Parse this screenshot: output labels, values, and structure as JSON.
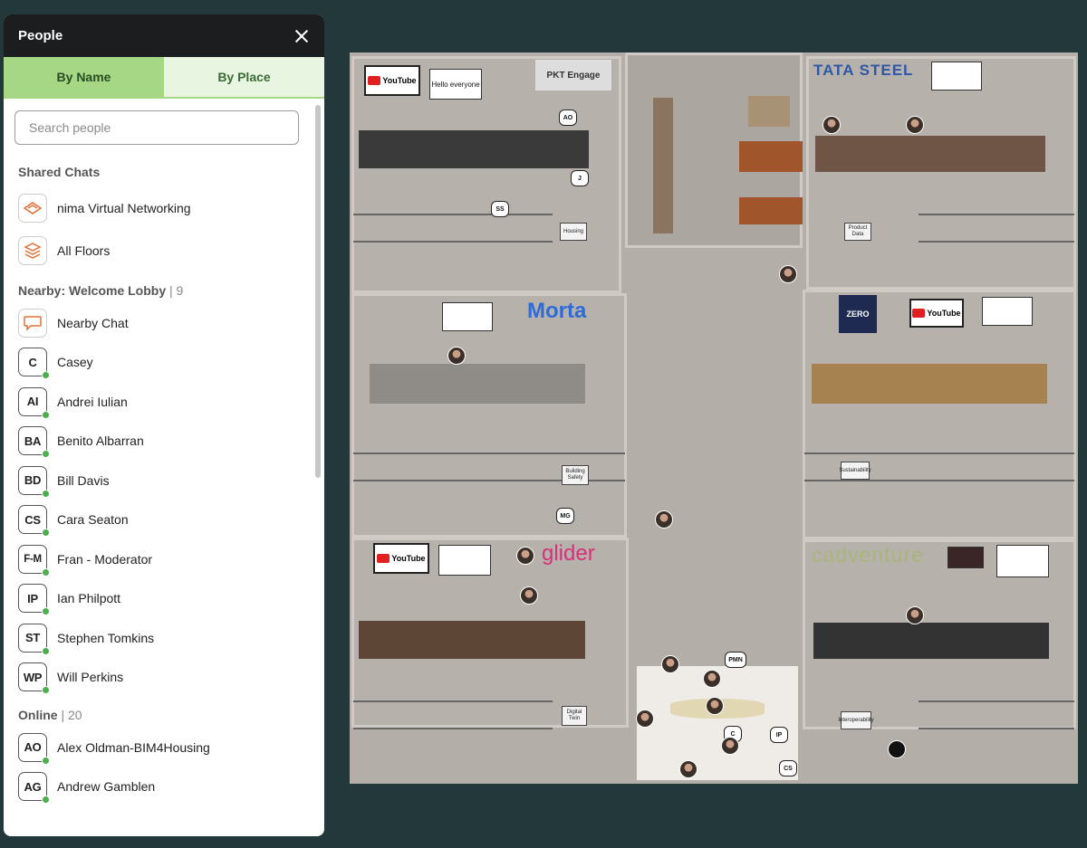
{
  "panel": {
    "title": "People",
    "tabs": [
      "By Name",
      "By Place"
    ],
    "search_placeholder": "Search people",
    "shared_chats_title": "Shared Chats",
    "shared_chats": [
      {
        "label": "nima Virtual Networking",
        "icon": "nima-logo-icon"
      },
      {
        "label": "All Floors",
        "icon": "layers-icon"
      }
    ],
    "nearby_title": "Nearby: Welcome Lobby",
    "nearby_count": "9",
    "nearby_chat_label": "Nearby Chat",
    "nearby": [
      {
        "initials": "C",
        "name": "Casey"
      },
      {
        "initials": "AI",
        "name": "Andrei Iulian"
      },
      {
        "initials": "BA",
        "name": "Benito Albarran"
      },
      {
        "initials": "BD",
        "name": "Bill Davis"
      },
      {
        "initials": "CS",
        "name": "Cara Seaton"
      },
      {
        "initials": "F-M",
        "name": "Fran - Moderator"
      },
      {
        "initials": "IP",
        "name": "Ian Philpott"
      },
      {
        "initials": "ST",
        "name": "Stephen Tomkins"
      },
      {
        "initials": "WP",
        "name": "Will Perkins"
      }
    ],
    "online_title": "Online",
    "online_count": "20",
    "online": [
      {
        "initials": "AO",
        "name": "Alex Oldman-BIM4Housing"
      },
      {
        "initials": "AG",
        "name": "Andrew Gamblen"
      }
    ]
  },
  "map": {
    "brands": {
      "pkt": "PKT Engage",
      "tata": "TATA STEEL",
      "morta": "Morta",
      "zero": "ZERO",
      "glider": "glider",
      "cadventure": "cadventure",
      "youtube": "YouTube"
    },
    "screens": {
      "hello": "Hello everyone"
    },
    "signs": {
      "housing": "Housing",
      "product": "Product Data",
      "building_safety": "Building Safety",
      "sustainability": "Sustainability",
      "digital_twin": "Digital Twin",
      "interoperability": "Interoperability"
    },
    "avatar_labels": {
      "ao": "AO",
      "j": "J",
      "ss": "SS",
      "mg": "MG",
      "pmn": "PMN",
      "ip": "IP",
      "cs": "CS",
      "c": "C"
    }
  },
  "colors": {
    "accent": "#a6d785",
    "online": "#4cae4c",
    "background": "#23383a"
  }
}
